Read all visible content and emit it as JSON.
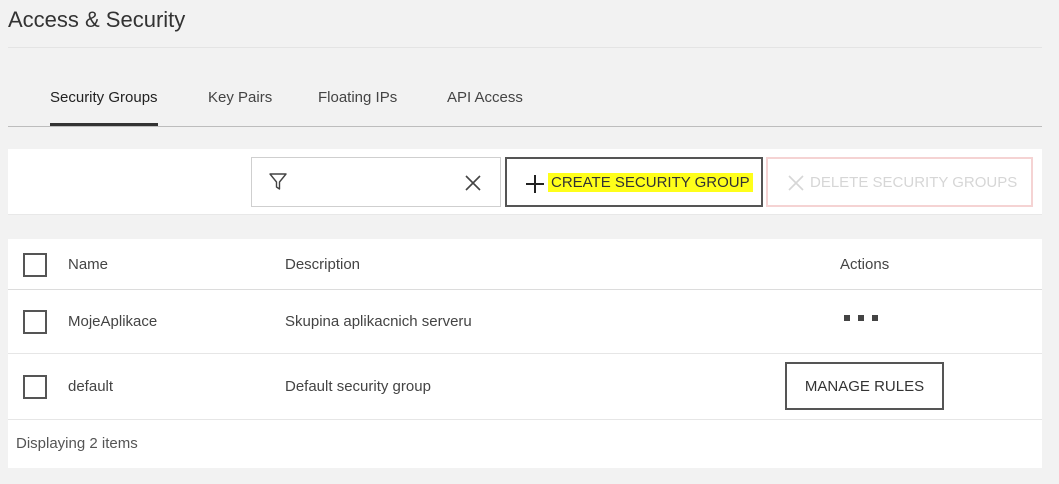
{
  "page": {
    "title": "Access & Security"
  },
  "tabs": [
    {
      "label": "Security Groups",
      "active": true
    },
    {
      "label": "Key Pairs",
      "active": false
    },
    {
      "label": "Floating IPs",
      "active": false
    },
    {
      "label": "API Access",
      "active": false
    }
  ],
  "toolbar": {
    "filter": {
      "value": "",
      "icon": "filter-icon",
      "clear_icon": "close-icon"
    },
    "create_label": "CREATE SECURITY GROUP",
    "create_icon": "plus-icon",
    "create_highlight_color": "#ffff1a",
    "delete_label": "DELETE SECURITY GROUPS",
    "delete_icon": "close-icon",
    "delete_disabled": true
  },
  "table": {
    "columns": {
      "name": "Name",
      "description": "Description",
      "actions": "Actions"
    },
    "rows": [
      {
        "name": "MojeAplikace",
        "description": "Skupina aplikacnich serveru",
        "action": "more-options-icon"
      },
      {
        "name": "default",
        "description": "Default security group",
        "action_label": "MANAGE RULES"
      }
    ],
    "footer": "Displaying 2 items"
  }
}
